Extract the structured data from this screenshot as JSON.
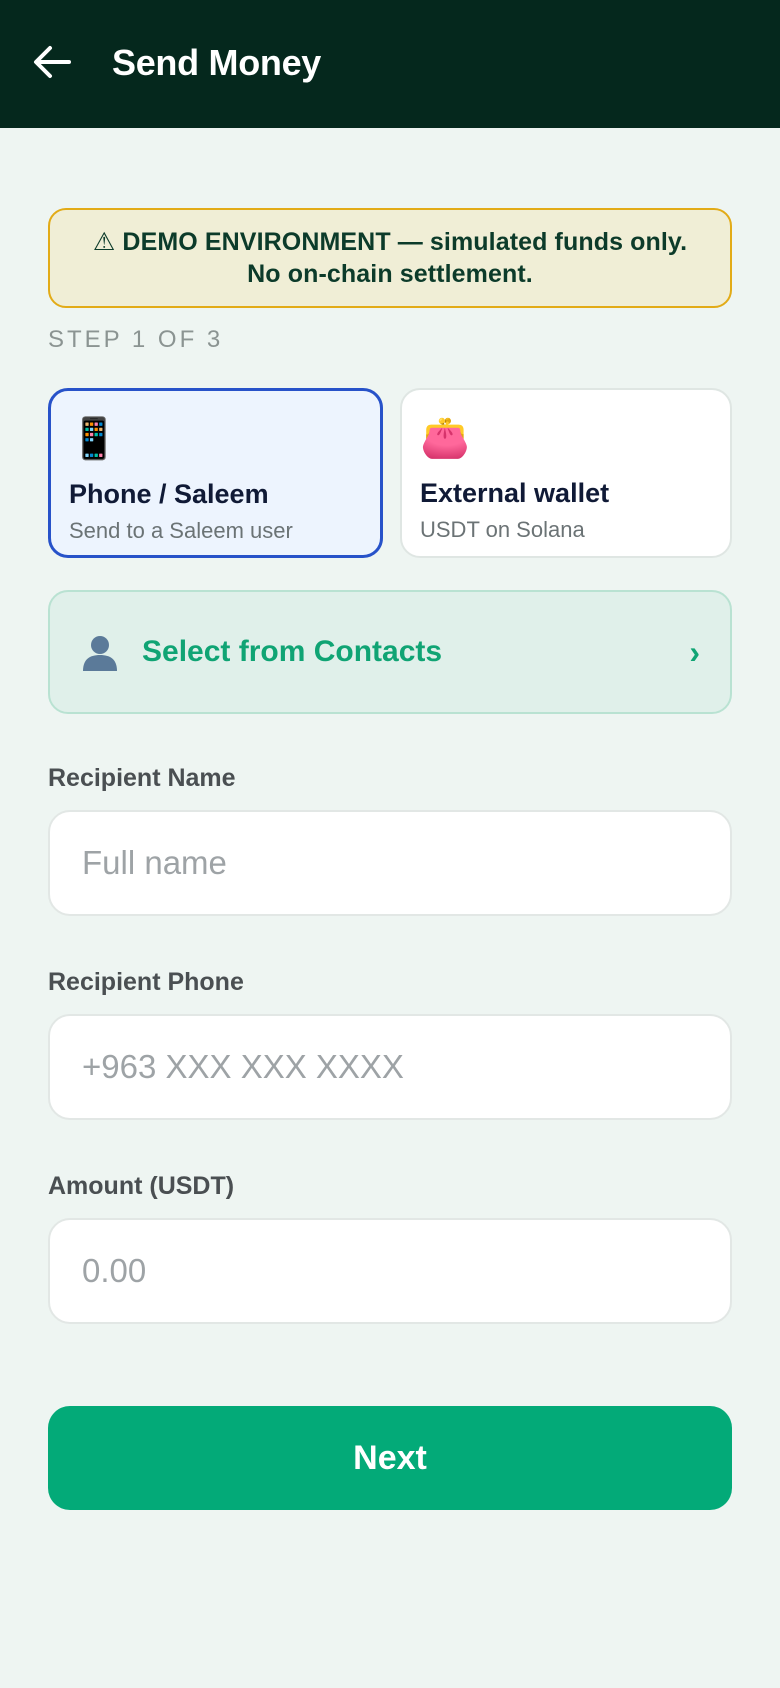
{
  "header": {
    "back_icon": "arrow-left-icon",
    "title": "Send Money"
  },
  "demo_banner": {
    "icon": "warning-icon",
    "text": "⚠ DEMO ENVIRONMENT — simulated funds only. No on-chain settlement."
  },
  "step": {
    "label": "STEP 1 OF 3"
  },
  "methods": [
    {
      "icon": "📱",
      "icon_name": "mobile-phone-icon",
      "title": "Phone / Saleem",
      "subtitle": "Send to a Saleem user",
      "selected": true
    },
    {
      "icon": "👛",
      "icon_name": "purse-wallet-icon",
      "title": "External wallet",
      "subtitle": "USDT on Solana",
      "selected": false
    }
  ],
  "contacts": {
    "icon": "person-silhouette-icon",
    "label": "Select from Contacts",
    "chevron": "›"
  },
  "fields": {
    "name": {
      "label": "Recipient Name",
      "placeholder": "Full name",
      "value": ""
    },
    "phone": {
      "label": "Recipient Phone",
      "placeholder": "+963 XXX XXX XXXX",
      "value": ""
    },
    "amount": {
      "label": "Amount (USDT)",
      "placeholder": "0.00",
      "value": ""
    }
  },
  "next_button": {
    "label": "Next"
  },
  "colors": {
    "header_bg": "#05281d",
    "background": "#eef5f2",
    "accent_green": "#03aa78",
    "selected_border": "#2752c9",
    "warning_border": "#e2ab17",
    "warning_bg": "#f0eed6"
  }
}
